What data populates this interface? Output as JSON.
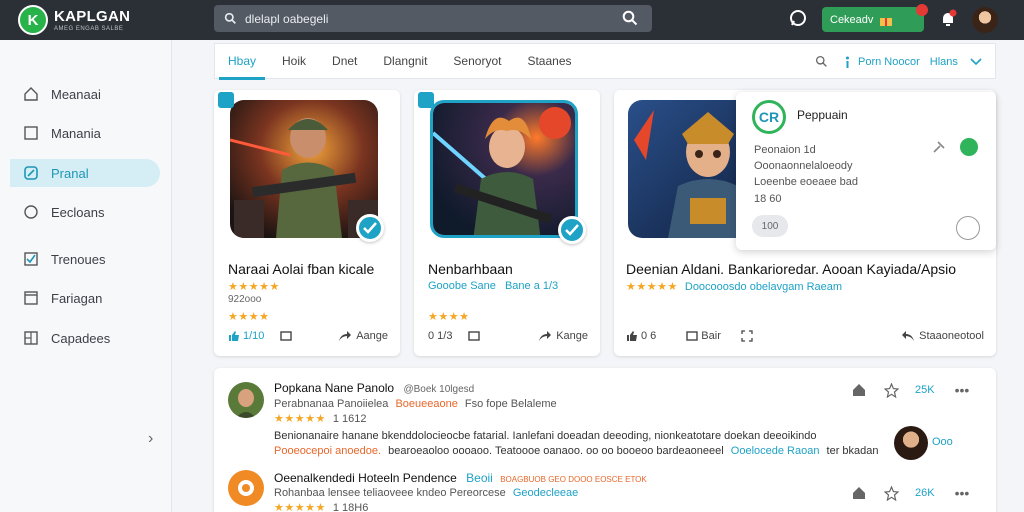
{
  "app": {
    "name": "KAPLGAN",
    "tagline": "AMEG ENGAB SALBE"
  },
  "search": {
    "placeholder": "dlelapl oabegeli"
  },
  "topbar": {
    "cart_label": "Cekeadv"
  },
  "sidebar": {
    "items": [
      {
        "label": "Meanaai",
        "icon": "home-icon"
      },
      {
        "label": "Manania",
        "icon": "square-icon"
      },
      {
        "label": "Pranal",
        "icon": "edit-icon",
        "active": true
      },
      {
        "label": "Eecloans",
        "icon": "circle-icon"
      },
      {
        "label": "Trenoues",
        "icon": "checkbox-icon"
      },
      {
        "label": "Fariagan",
        "icon": "bookmark-icon"
      },
      {
        "label": "Capadees",
        "icon": "grid-icon"
      }
    ]
  },
  "tabs": {
    "items": [
      "Hbay",
      "Hoik",
      "Dnet",
      "Dlangnit",
      "Senoryot",
      "Staanes"
    ],
    "filter_a": "Porn Noocor",
    "filter_b": "Hlans"
  },
  "cards": [
    {
      "title": "Naraai Aolai fban kicale",
      "rating_stars": "★★★★★",
      "sub2": "922ooo",
      "stars2": "★★★★",
      "action_a": "1/10",
      "action_b": "Aange"
    },
    {
      "title": "Nenbarhbaan",
      "sub_text": "Gooobe Sane",
      "sub_meta": "Bane a 1/3",
      "stars2": "★★★★",
      "action_a": "0 1/3",
      "action_b": "Kange"
    },
    {
      "title": "Deenian Aldani. Bankarioredar. Aooan Kayiada/Apsio",
      "rating_stars": "★★★★★",
      "sub_text": "Doocooosdo obelavgam Raeam",
      "action_a": "0 6",
      "action_b": "Bair",
      "action_c": "Staaoneotool"
    }
  ],
  "popup": {
    "logo_text": "CR",
    "title": "Peppuain",
    "lines": [
      "Peonaion 1d",
      "Ooonaonnelaloeody",
      "Loeenbe eoeaee bad",
      "18 60"
    ],
    "chip": "100"
  },
  "feed": [
    {
      "name": "Popkana Nane Panolo",
      "handle": "@Boek  10lgesd",
      "line1_a": "Perabnanaa Panoiielea",
      "line1_b": "Boeueeaone",
      "line1_c": "Fso fope Belaleme",
      "stars": "★★★★★",
      "meta": "1 1612",
      "body1": "Benionanaire hanane bkenddolocieocbe fatarial. Ianlefani doeadan deeoding, nionkeatotare doekan deeoikindo",
      "body2_a": "Pooeocepoi anoedoe.",
      "body2_b": "bearoeaoloo oooaoo. Teatoooe oanaoo. oo oo booeoo bardeaoneeel",
      "body2_c": "Ooelocede Raoan",
      "body2_d": "ter bkadan",
      "count": "25K",
      "side_label": "Ooo"
    },
    {
      "name": "Oeenalkendedi Hoteeln Pendence",
      "handle": "Beoii",
      "tag": "BOAGBUOB GEO DOOO EOSCE ETOK",
      "line1": "Rohanbaa lensee teliaoveee kndeo Pereorcese",
      "line1_b": "Geodecleeae",
      "stars": "★★★★★",
      "meta": "1 18H6",
      "count": "26K"
    }
  ]
}
